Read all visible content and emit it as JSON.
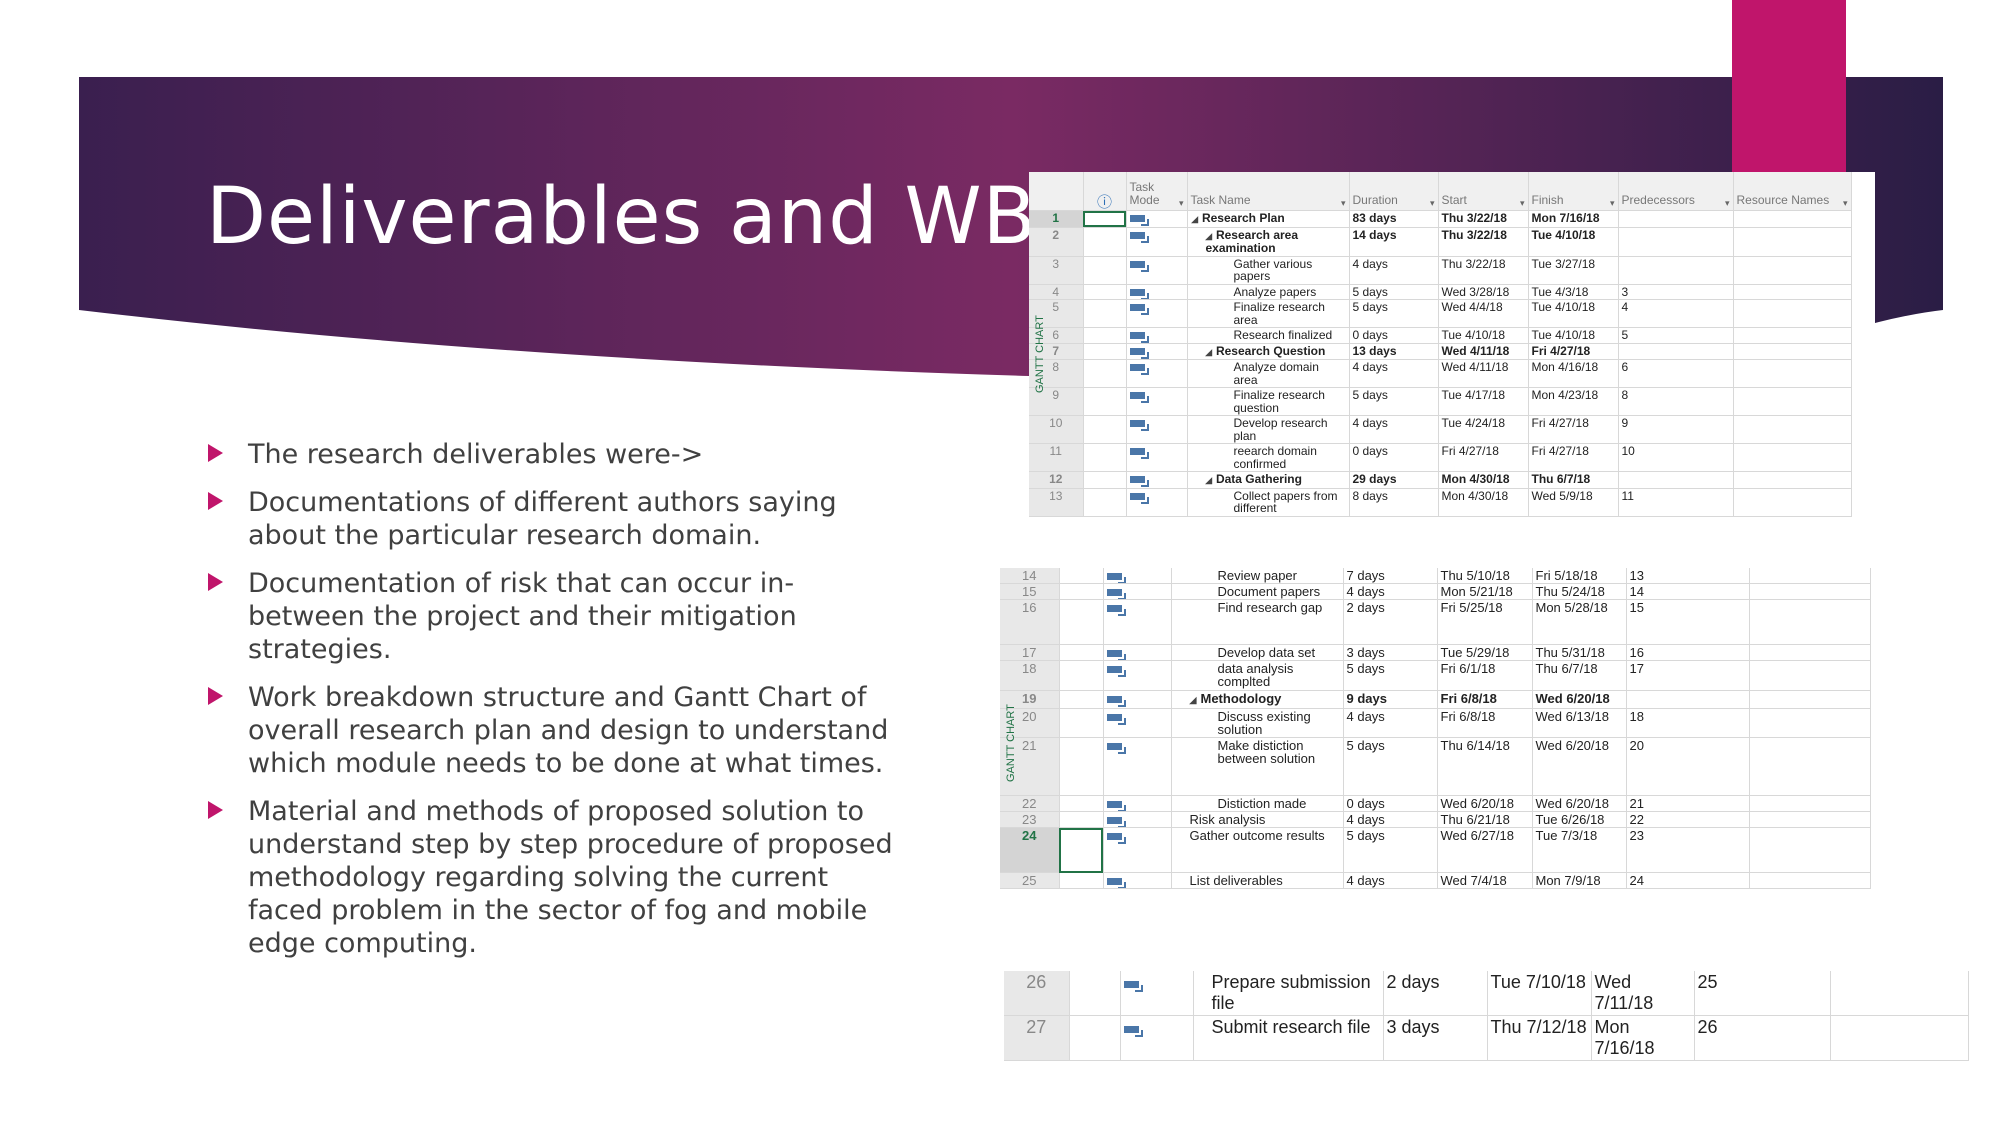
{
  "slide": {
    "title": "Deliverables and WBS",
    "colors": {
      "banner_start": "#3a1f4f",
      "banner_end": "#8a2d6a",
      "accent": "#c0156b",
      "text": "#404040",
      "gantt_label": "#217346"
    },
    "bullets": [
      "The research deliverables were->",
      "Documentations of different authors saying about the particular research domain.",
      "Documentation of risk that can occur in-between the project and their mitigation strategies.",
      "Work breakdown structure and Gantt Chart of overall research plan and design to understand which module needs to be done at what times.",
      "Material and methods of proposed solution to understand step by step procedure of proposed methodology regarding solving the current faced problem in the sector of fog and mobile edge computing."
    ]
  },
  "gantt": {
    "side_label": "GANTT CHART",
    "columns": [
      "",
      "info-icon",
      "Task Mode",
      "Task Name",
      "Duration",
      "Start",
      "Finish",
      "Predecessors",
      "Resource Names"
    ],
    "tables": [
      {
        "rows": [
          {
            "id": "1",
            "name": "Research Plan",
            "duration": "83 days",
            "start": "Thu 3/22/18",
            "finish": "Mon 7/16/18",
            "pred": "",
            "summary": true,
            "level": 0,
            "selected": true
          },
          {
            "id": "2",
            "name": "Research area examination",
            "duration": "14 days",
            "start": "Thu 3/22/18",
            "finish": "Tue 4/10/18",
            "pred": "",
            "summary": true,
            "level": 1
          },
          {
            "id": "3",
            "name": "Gather various papers",
            "duration": "4 days",
            "start": "Thu 3/22/18",
            "finish": "Tue 3/27/18",
            "pred": "",
            "level": 2
          },
          {
            "id": "4",
            "name": "Analyze papers",
            "duration": "5 days",
            "start": "Wed 3/28/18",
            "finish": "Tue 4/3/18",
            "pred": "3",
            "level": 2
          },
          {
            "id": "5",
            "name": "Finalize research area",
            "duration": "5 days",
            "start": "Wed 4/4/18",
            "finish": "Tue 4/10/18",
            "pred": "4",
            "level": 2
          },
          {
            "id": "6",
            "name": "Research finalized",
            "duration": "0 days",
            "start": "Tue 4/10/18",
            "finish": "Tue 4/10/18",
            "pred": "5",
            "level": 2
          },
          {
            "id": "7",
            "name": "Research Question",
            "duration": "13 days",
            "start": "Wed 4/11/18",
            "finish": "Fri 4/27/18",
            "pred": "",
            "summary": true,
            "level": 1
          },
          {
            "id": "8",
            "name": "Analyze domain area",
            "duration": "4 days",
            "start": "Wed 4/11/18",
            "finish": "Mon 4/16/18",
            "pred": "6",
            "level": 2
          },
          {
            "id": "9",
            "name": "Finalize research question",
            "duration": "5 days",
            "start": "Tue 4/17/18",
            "finish": "Mon 4/23/18",
            "pred": "8",
            "level": 2
          },
          {
            "id": "10",
            "name": "Develop research plan",
            "duration": "4 days",
            "start": "Tue 4/24/18",
            "finish": "Fri 4/27/18",
            "pred": "9",
            "level": 2
          },
          {
            "id": "11",
            "name": "reearch domain confirmed",
            "duration": "0 days",
            "start": "Fri 4/27/18",
            "finish": "Fri 4/27/18",
            "pred": "10",
            "level": 2
          },
          {
            "id": "12",
            "name": "Data Gathering",
            "duration": "29 days",
            "start": "Mon 4/30/18",
            "finish": "Thu 6/7/18",
            "pred": "",
            "summary": true,
            "level": 1
          },
          {
            "id": "13",
            "name": "Collect papers from different",
            "duration": "8 days",
            "start": "Mon 4/30/18",
            "finish": "Wed 5/9/18",
            "pred": "11",
            "level": 2
          }
        ]
      },
      {
        "rows": [
          {
            "id": "14",
            "name": "Review paper",
            "duration": "7 days",
            "start": "Thu 5/10/18",
            "finish": "Fri 5/18/18",
            "pred": "13",
            "level": 2
          },
          {
            "id": "15",
            "name": "Document papers",
            "duration": "4 days",
            "start": "Mon 5/21/18",
            "finish": "Thu 5/24/18",
            "pred": "14",
            "level": 2
          },
          {
            "id": "16",
            "name": "Find research gap",
            "duration": "2 days",
            "start": "Fri 5/25/18",
            "finish": "Mon 5/28/18",
            "pred": "15",
            "level": 2,
            "lines": 3
          },
          {
            "id": "17",
            "name": "Develop data set",
            "duration": "3 days",
            "start": "Tue 5/29/18",
            "finish": "Thu 5/31/18",
            "pred": "16",
            "level": 2
          },
          {
            "id": "18",
            "name": "data analysis complted",
            "duration": "5 days",
            "start": "Fri 6/1/18",
            "finish": "Thu 6/7/18",
            "pred": "17",
            "level": 2
          },
          {
            "id": "19",
            "name": "Methodology",
            "duration": "9 days",
            "start": "Fri 6/8/18",
            "finish": "Wed 6/20/18",
            "pred": "",
            "summary": true,
            "level": 1
          },
          {
            "id": "20",
            "name": "Discuss existing solution",
            "duration": "4 days",
            "start": "Fri 6/8/18",
            "finish": "Wed 6/13/18",
            "pred": "18",
            "level": 2
          },
          {
            "id": "21",
            "name": "Make distiction between solution",
            "duration": "5 days",
            "start": "Thu 6/14/18",
            "finish": "Wed 6/20/18",
            "pred": "20",
            "level": 2,
            "lines": 4
          },
          {
            "id": "22",
            "name": "Distiction made",
            "duration": "0 days",
            "start": "Wed 6/20/18",
            "finish": "Wed 6/20/18",
            "pred": "21",
            "level": 2
          },
          {
            "id": "23",
            "name": "Risk analysis",
            "duration": "4 days",
            "start": "Thu 6/21/18",
            "finish": "Tue 6/26/18",
            "pred": "22",
            "level": 1
          },
          {
            "id": "24",
            "name": "Gather outcome results",
            "duration": "5 days",
            "start": "Wed 6/27/18",
            "finish": "Tue 7/3/18",
            "pred": "23",
            "level": 1,
            "selected": true,
            "lines": 3
          },
          {
            "id": "25",
            "name": "List deliverables",
            "duration": "4 days",
            "start": "Wed 7/4/18",
            "finish": "Mon 7/9/18",
            "pred": "24",
            "level": 1
          }
        ]
      },
      {
        "rows": [
          {
            "id": "26",
            "name": "Prepare submission file",
            "duration": "2 days",
            "start": "Tue 7/10/18",
            "finish": "Wed 7/11/18",
            "pred": "25",
            "level": 1
          },
          {
            "id": "27",
            "name": "Submit research file",
            "duration": "3 days",
            "start": "Thu 7/12/18",
            "finish": "Mon 7/16/18",
            "pred": "26",
            "level": 1
          }
        ]
      }
    ]
  }
}
